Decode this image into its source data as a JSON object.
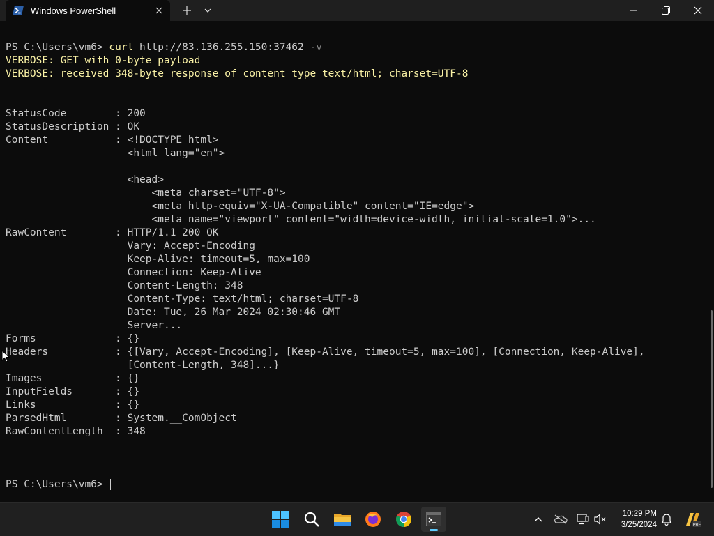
{
  "window": {
    "tab_title": "Windows PowerShell",
    "new_tab_symbol": "+",
    "dropdown_symbol": "chevron-down-icon"
  },
  "terminal": {
    "lines": [
      {
        "segments": [
          {
            "t": "PS C:\\Users\\vm6> ",
            "c": ""
          },
          {
            "t": "curl",
            "c": "c-yellow"
          },
          {
            "t": " http://83.136.255.150:37462 ",
            "c": ""
          },
          {
            "t": "-v",
            "c": "c-gray"
          }
        ]
      },
      {
        "segments": [
          {
            "t": "VERBOSE: GET with 0-byte payload",
            "c": "c-yellow"
          }
        ]
      },
      {
        "segments": [
          {
            "t": "VERBOSE: received 348-byte response of content type text/html; charset=UTF-8",
            "c": "c-yellow"
          }
        ]
      },
      {
        "segments": []
      },
      {
        "segments": []
      },
      {
        "segments": [
          {
            "t": "StatusCode        : 200",
            "c": ""
          }
        ]
      },
      {
        "segments": [
          {
            "t": "StatusDescription : OK",
            "c": ""
          }
        ]
      },
      {
        "segments": [
          {
            "t": "Content           : <!DOCTYPE html>",
            "c": ""
          }
        ]
      },
      {
        "segments": [
          {
            "t": "                    <html lang=\"en\">",
            "c": ""
          }
        ]
      },
      {
        "segments": []
      },
      {
        "segments": [
          {
            "t": "                    <head>",
            "c": ""
          }
        ]
      },
      {
        "segments": [
          {
            "t": "                        <meta charset=\"UTF-8\">",
            "c": ""
          }
        ]
      },
      {
        "segments": [
          {
            "t": "                        <meta http-equiv=\"X-UA-Compatible\" content=\"IE=edge\">",
            "c": ""
          }
        ]
      },
      {
        "segments": [
          {
            "t": "                        <meta name=\"viewport\" content=\"width=device-width, initial-scale=1.0\">...",
            "c": ""
          }
        ]
      },
      {
        "segments": [
          {
            "t": "RawContent        : HTTP/1.1 200 OK",
            "c": ""
          }
        ]
      },
      {
        "segments": [
          {
            "t": "                    Vary: Accept-Encoding",
            "c": ""
          }
        ]
      },
      {
        "segments": [
          {
            "t": "                    Keep-Alive: timeout=5, max=100",
            "c": ""
          }
        ]
      },
      {
        "segments": [
          {
            "t": "                    Connection: Keep-Alive",
            "c": ""
          }
        ]
      },
      {
        "segments": [
          {
            "t": "                    Content-Length: 348",
            "c": ""
          }
        ]
      },
      {
        "segments": [
          {
            "t": "                    Content-Type: text/html; charset=UTF-8",
            "c": ""
          }
        ]
      },
      {
        "segments": [
          {
            "t": "                    Date: Tue, 26 Mar 2024 02:30:46 GMT",
            "c": ""
          }
        ]
      },
      {
        "segments": [
          {
            "t": "                    Server...",
            "c": ""
          }
        ]
      },
      {
        "segments": [
          {
            "t": "Forms             : {}",
            "c": ""
          }
        ]
      },
      {
        "segments": [
          {
            "t": "Headers           : {[Vary, Accept-Encoding], [Keep-Alive, timeout=5, max=100], [Connection, Keep-Alive],",
            "c": ""
          }
        ]
      },
      {
        "segments": [
          {
            "t": "                    [Content-Length, 348]...}",
            "c": ""
          }
        ]
      },
      {
        "segments": [
          {
            "t": "Images            : {}",
            "c": ""
          }
        ]
      },
      {
        "segments": [
          {
            "t": "InputFields       : {}",
            "c": ""
          }
        ]
      },
      {
        "segments": [
          {
            "t": "Links             : {}",
            "c": ""
          }
        ]
      },
      {
        "segments": [
          {
            "t": "ParsedHtml        : System.__ComObject",
            "c": ""
          }
        ]
      },
      {
        "segments": [
          {
            "t": "RawContentLength  : 348",
            "c": ""
          }
        ]
      },
      {
        "segments": []
      },
      {
        "segments": []
      },
      {
        "segments": []
      }
    ],
    "prompt": "PS C:\\Users\\vm6> "
  },
  "taskbar": {
    "apps": [
      "start-icon",
      "search-icon",
      "file-explorer-icon",
      "firefox-icon",
      "chrome-icon",
      "terminal-icon"
    ],
    "clock_time": "10:29 PM",
    "clock_date": "3/25/2024"
  },
  "colors": {
    "terminal_bg": "#0c0c0c",
    "terminal_fg": "#cccccc",
    "verbose": "#f9f1a5",
    "titlebar": "#1f1f1f",
    "taskbar": "#202020",
    "accent": "#60cdff"
  }
}
